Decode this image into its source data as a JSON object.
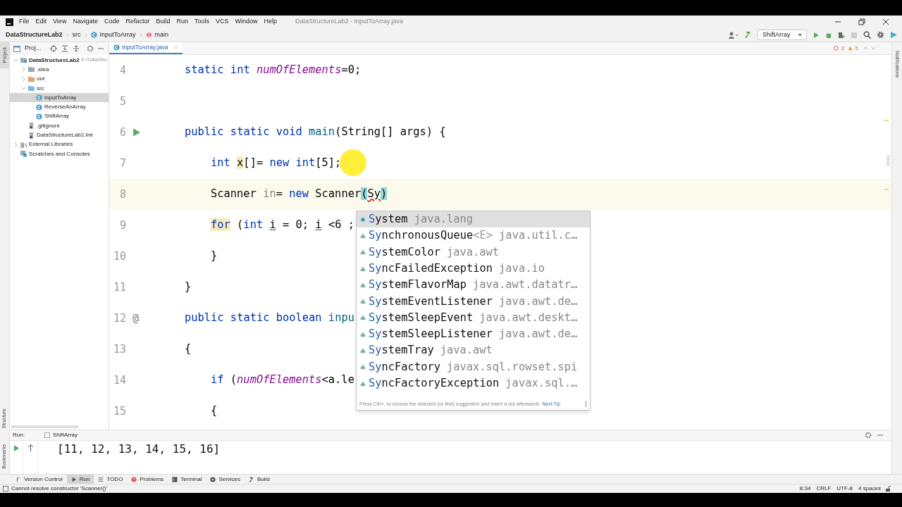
{
  "menu_bar": {
    "items": [
      "File",
      "Edit",
      "View",
      "Navigate",
      "Code",
      "Refactor",
      "Build",
      "Run",
      "Tools",
      "VCS",
      "Window",
      "Help"
    ],
    "title": "DataStructureLab2 - InputToArray.java"
  },
  "breadcrumbs": [
    {
      "text": "DataStructureLab2",
      "kind": "project"
    },
    {
      "text": "src",
      "kind": "folder"
    },
    {
      "text": "InputToArray",
      "kind": "class"
    },
    {
      "text": "main",
      "kind": "method"
    }
  ],
  "run_config": "ShiftArray",
  "left_strip": {
    "top": [
      "Project"
    ],
    "bottom": [
      "Structure",
      "Bookmarks"
    ]
  },
  "right_strip": [
    "Notifications"
  ],
  "project_panel": {
    "title": "Proj...",
    "tree": [
      {
        "label": "DataStructureLab2",
        "hint": "E:\\DataStru",
        "kind": "module",
        "expanded": true,
        "selected": false,
        "children": [
          {
            "label": ".idea",
            "kind": "folder",
            "expanded": false,
            "selected": false
          },
          {
            "label": "out",
            "kind": "folder-excluded",
            "expanded": false,
            "selected": false
          },
          {
            "label": "src",
            "kind": "folder-source",
            "expanded": true,
            "selected": false,
            "children": [
              {
                "label": "InputToArray",
                "kind": "class",
                "selected": true
              },
              {
                "label": "ReverseAnArray",
                "kind": "class",
                "selected": false
              },
              {
                "label": "ShiftArray",
                "kind": "class",
                "selected": false
              }
            ]
          },
          {
            "label": ".gitignore",
            "kind": "file",
            "selected": false
          },
          {
            "label": "DataStructureLab2.iml",
            "kind": "file",
            "selected": false
          }
        ]
      },
      {
        "label": "External Libraries",
        "kind": "library",
        "expanded": false,
        "selected": false
      },
      {
        "label": "Scratches and Consoles",
        "kind": "scratch",
        "selected": false
      }
    ]
  },
  "editor": {
    "tab": {
      "label": "InputToArray.java",
      "selected": true
    },
    "inspection": {
      "errors": "2",
      "warnings": "5"
    },
    "lines": [
      {
        "number": "4",
        "segments": [
          {
            "text": "static int ",
            "kind": "kw"
          },
          {
            "text": "numOfElements",
            "kind": "field"
          },
          {
            "text": "=0;",
            "kind": "plain"
          }
        ]
      },
      {
        "number": "5"
      },
      {
        "number": "6",
        "runnable": true,
        "segments": [
          {
            "text": "public static void ",
            "kind": "kw"
          },
          {
            "text": "main",
            "kind": "method"
          },
          {
            "text": "(String[] args) {",
            "kind": "plain"
          }
        ]
      },
      {
        "number": "7",
        "indented": true,
        "segments": [
          {
            "text": "int ",
            "kind": "kw"
          },
          {
            "text": "x",
            "kind": "plain",
            "highlighted": true
          },
          {
            "text": "[]= ",
            "kind": "plain"
          },
          {
            "text": "new int",
            "kind": "kw"
          },
          {
            "text": "[5];",
            "kind": "plain"
          }
        ]
      },
      {
        "number": "8",
        "indented": true,
        "current": true,
        "segments": [
          {
            "text": "Scanner ",
            "kind": "plain"
          },
          {
            "text": "in",
            "kind": "unused"
          },
          {
            "text": "= ",
            "kind": "plain"
          },
          {
            "text": "new ",
            "kind": "kw"
          },
          {
            "text": "Scanner",
            "kind": "plain"
          },
          {
            "text": "(",
            "kind": "plain",
            "brace_match": true
          },
          {
            "text": "Sy",
            "kind": "error"
          },
          {
            "text": ")",
            "kind": "plain",
            "brace_match": true
          }
        ]
      },
      {
        "number": "9",
        "indented": true,
        "segments": [
          {
            "text": "for",
            "kind": "kw",
            "highlighted": true
          },
          {
            "text": " (",
            "kind": "plain"
          },
          {
            "text": "int ",
            "kind": "kw"
          },
          {
            "text": "i",
            "kind": "reassigned"
          },
          {
            "text": " = 0; ",
            "kind": "plain"
          },
          {
            "text": "i",
            "kind": "reassigned"
          },
          {
            "text": " <6 ;",
            "kind": "plain"
          }
        ]
      },
      {
        "number": "10",
        "indented": true,
        "segments": [
          {
            "text": "}",
            "kind": "plain"
          }
        ]
      },
      {
        "number": "11",
        "segments": [
          {
            "text": "}",
            "kind": "plain"
          }
        ]
      },
      {
        "number": "12",
        "gutter": "@",
        "segments": [
          {
            "text": "public static boolean ",
            "kind": "kw"
          },
          {
            "text": "inpu",
            "kind": "method"
          }
        ]
      },
      {
        "number": "13",
        "segments": [
          {
            "text": "{",
            "kind": "plain"
          }
        ]
      },
      {
        "number": "14",
        "indented": true,
        "segments": [
          {
            "text": "if ",
            "kind": "kw"
          },
          {
            "text": "(",
            "kind": "plain"
          },
          {
            "text": "numOfElements",
            "kind": "field"
          },
          {
            "text": "<a.le",
            "kind": "plain"
          }
        ]
      },
      {
        "number": "15",
        "indented": true,
        "segments": [
          {
            "text": "{",
            "kind": "plain"
          }
        ]
      }
    ]
  },
  "completion": {
    "items": [
      {
        "name": "S",
        "rest": "ystem",
        "package": "java.lang",
        "selected": true
      },
      {
        "name": "Sy",
        "rest": "nchronousQueue",
        "generic": "<E>",
        "package": "java.util.c…",
        "selected": false
      },
      {
        "name": "Sy",
        "rest": "stemColor",
        "package": "java.awt",
        "selected": false
      },
      {
        "name": "Sy",
        "rest": "ncFailedException",
        "package": "java.io",
        "selected": false
      },
      {
        "name": "Sy",
        "rest": "stemFlavorMap",
        "package": "java.awt.datatr…",
        "selected": false
      },
      {
        "name": "Sy",
        "rest": "stemEventListener",
        "package": "java.awt.de…",
        "selected": false
      },
      {
        "name": "Sy",
        "rest": "stemSleepEvent",
        "package": "java.awt.deskt…",
        "selected": false
      },
      {
        "name": "Sy",
        "rest": "stemSleepListener",
        "package": "java.awt.de…",
        "selected": false
      },
      {
        "name": "Sy",
        "rest": "stemTray",
        "package": "java.awt",
        "selected": false
      },
      {
        "name": "Sy",
        "rest": "ncFactory",
        "package": "javax.sql.rowset.spi",
        "selected": false
      },
      {
        "name": "Sy",
        "rest": "ncFactoryException",
        "package": "javax.sql.…",
        "selected": false
      }
    ],
    "hint": "Press Ctrl+. to choose the selected (or first) suggestion and insert a dot afterwards",
    "next_tip": "Next Tip"
  },
  "run_panel": {
    "label": "Run:",
    "tab": "ShiftArray",
    "output": [
      "[11, 12, 13, 14, 15, 16]"
    ]
  },
  "tool_windows": [
    {
      "label": "Version Control",
      "kind": "vcs",
      "selected": false
    },
    {
      "label": "Run",
      "kind": "run",
      "selected": true
    },
    {
      "label": "TODO",
      "kind": "list",
      "selected": false
    },
    {
      "label": "Problems",
      "kind": "problem",
      "selected": false
    },
    {
      "label": "Terminal",
      "kind": "terminal",
      "selected": false
    },
    {
      "label": "Services",
      "kind": "services",
      "selected": false
    },
    {
      "label": "Build",
      "kind": "hammer",
      "selected": false
    }
  ],
  "status_bar": {
    "message": "Cannot resolve constructor 'Scanner()'",
    "items": [
      "8:34",
      "CRLF",
      "UTF-8",
      "4 spaces"
    ]
  }
}
